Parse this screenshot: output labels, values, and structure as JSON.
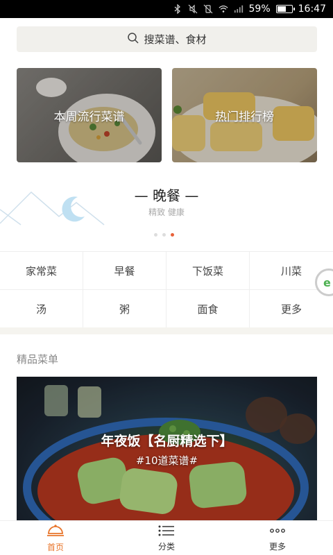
{
  "status_bar": {
    "battery_percent": "59%",
    "battery_level": 0.59,
    "time": "16:47",
    "icons": [
      "bluetooth-icon",
      "mute-icon",
      "vibrate-off-icon",
      "wifi-icon",
      "signal-icon"
    ]
  },
  "search": {
    "placeholder": "搜菜谱、食材",
    "icon": "search-icon"
  },
  "cards": [
    {
      "label": "本周流行菜谱"
    },
    {
      "label": "热门排行榜"
    }
  ],
  "meal": {
    "title": "— 晚餐 —",
    "subtitle": "精致 健康",
    "carousel_active": 3,
    "carousel_count": 3
  },
  "categories": [
    "家常菜",
    "早餐",
    "下饭菜",
    "川菜",
    "汤",
    "粥",
    "面食",
    "更多"
  ],
  "featured": {
    "section_title": "精品菜单",
    "title": "年夜饭【名厨精选下】",
    "subtitle": "#10道菜谱#"
  },
  "tabs": [
    {
      "label": "首页",
      "icon": "cloche-icon",
      "active": true
    },
    {
      "label": "分类",
      "icon": "list-icon",
      "active": false
    },
    {
      "label": "更多",
      "icon": "more-dots-icon",
      "active": false
    }
  ],
  "colors": {
    "accent": "#e8742a",
    "dot_active": "#e8623a",
    "search_bg": "#f1f0ec"
  }
}
